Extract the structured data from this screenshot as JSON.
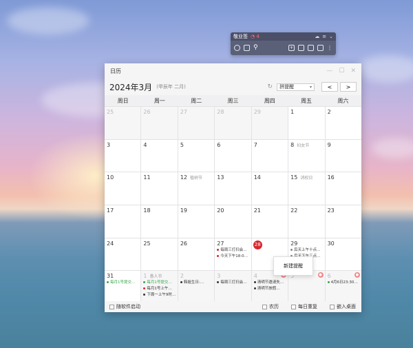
{
  "mini_toolbar": {
    "title": "敬业签",
    "badge": "4"
  },
  "window": {
    "title": "日历",
    "month_label": "2024年3月",
    "lunar_label": "(甲辰年 二月)",
    "select_value": "拼提醒",
    "prev_label": "<",
    "next_label": ">"
  },
  "weekdays": [
    "周日",
    "周一",
    "周二",
    "周三",
    "周四",
    "周五",
    "周六"
  ],
  "days": [
    {
      "d": "25",
      "other": true
    },
    {
      "d": "26",
      "other": true
    },
    {
      "d": "27",
      "other": true
    },
    {
      "d": "28",
      "other": true
    },
    {
      "d": "29",
      "other": true
    },
    {
      "d": "1"
    },
    {
      "d": "2"
    },
    {
      "d": "3"
    },
    {
      "d": "4"
    },
    {
      "d": "5"
    },
    {
      "d": "6"
    },
    {
      "d": "7"
    },
    {
      "d": "8",
      "fest": "妇女节"
    },
    {
      "d": "9"
    },
    {
      "d": "10"
    },
    {
      "d": "11"
    },
    {
      "d": "12",
      "fest": "植树节"
    },
    {
      "d": "13"
    },
    {
      "d": "14"
    },
    {
      "d": "15",
      "fest": "消权日"
    },
    {
      "d": "16"
    },
    {
      "d": "17"
    },
    {
      "d": "18"
    },
    {
      "d": "19"
    },
    {
      "d": "20"
    },
    {
      "d": "21"
    },
    {
      "d": "22"
    },
    {
      "d": "23"
    },
    {
      "d": "24"
    },
    {
      "d": "25"
    },
    {
      "d": "26"
    },
    {
      "d": "27",
      "events": [
        {
          "t": "每周三打扫会…",
          "c": "#d8262d"
        },
        {
          "t": "今天下午18:0…",
          "c": "#d8262d"
        }
      ]
    },
    {
      "d": "28",
      "today": true
    },
    {
      "d": "29",
      "events": [
        {
          "t": "后天上午十点…",
          "c": "#888"
        },
        {
          "t": "后天下午三点…",
          "c": "#888"
        }
      ]
    },
    {
      "d": "30"
    },
    {
      "d": "31",
      "events": [
        {
          "t": "每月1号提交…",
          "c": "#3aa64a",
          "green": true
        }
      ]
    },
    {
      "d": "1",
      "fest": "愚人节",
      "other": true,
      "events": [
        {
          "t": "每月1号提交…",
          "c": "#3aa64a",
          "green": true
        },
        {
          "t": "每月1号上午…",
          "c": "#d8262d"
        },
        {
          "t": "下周一上午9时…",
          "c": "#333"
        }
      ]
    },
    {
      "d": "2",
      "other": true,
      "events": [
        {
          "t": "韩姐生日:…",
          "c": "#333"
        }
      ]
    },
    {
      "d": "3",
      "other": true,
      "events": [
        {
          "t": "每周三打扫会…",
          "c": "#333"
        }
      ]
    },
    {
      "d": "4",
      "other": true,
      "corner": true,
      "events": [
        {
          "t": "清明节邀请失…",
          "c": "#333"
        },
        {
          "t": "清明节放假…",
          "c": "#333"
        }
      ]
    },
    {
      "d": "5",
      "other": true,
      "corner": true
    },
    {
      "d": "6",
      "other": true,
      "corner": true,
      "events": [
        {
          "t": "4月6日23:30…",
          "c": "#3aa64a"
        }
      ]
    }
  ],
  "context_menu": {
    "item": "新建提醒"
  },
  "footer": {
    "autostart": "随软件启动",
    "lunar": "农历",
    "daily_repeat": "每日重复",
    "embed_desktop": "嵌入桌面"
  },
  "colors": {
    "accent_red": "#d8262d",
    "event_green": "#3aa64a"
  }
}
